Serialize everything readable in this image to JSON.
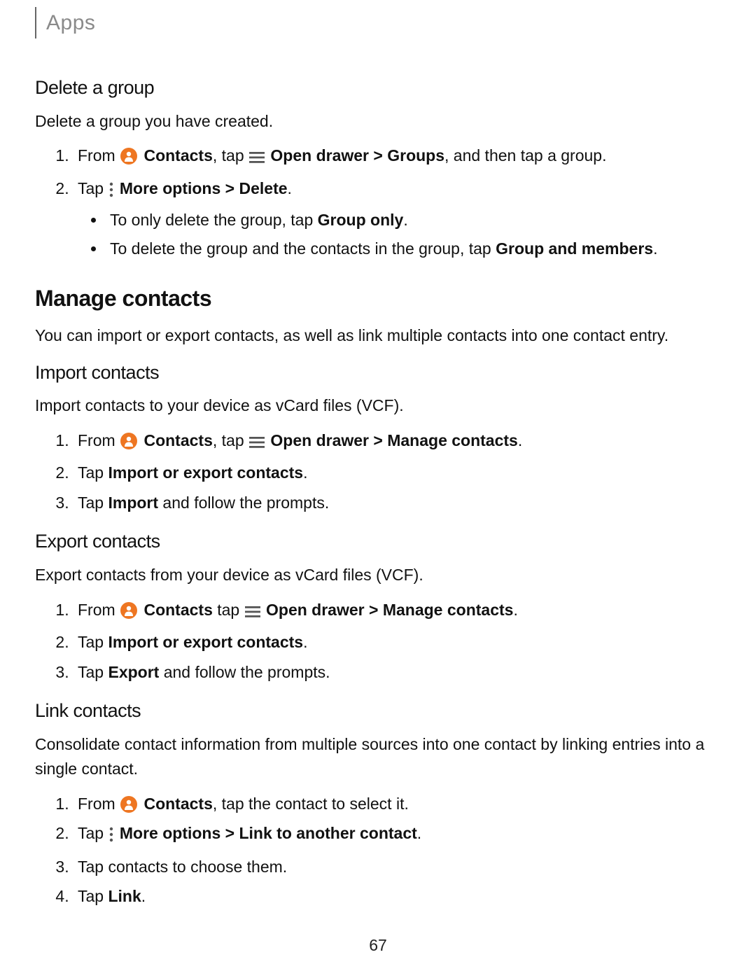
{
  "breadcrumb": "Apps",
  "pagenum": "67",
  "sections": {
    "delete_group": {
      "title": "Delete a group",
      "intro": "Delete a group you have created.",
      "step1": {
        "from": "From ",
        "contacts": "Contacts",
        "comma_tap": ", tap ",
        "open_drawer": "Open drawer",
        "gt": " > ",
        "groups": "Groups",
        "rest": ", and then tap a group."
      },
      "step2": {
        "tap": "Tap ",
        "more_options": "More options",
        "gt": " > ",
        "delete": "Delete",
        "period": "."
      },
      "bullets": {
        "b1_a": "To only delete the group, tap ",
        "b1_bold": "Group only",
        "b1_b": ".",
        "b2_a": "To delete the group and the contacts in the group, tap ",
        "b2_bold": "Group and members",
        "b2_b": "."
      }
    },
    "manage_contacts": {
      "title": "Manage contacts",
      "intro": "You can import or export contacts, as well as link multiple contacts into one contact entry."
    },
    "import_contacts": {
      "title": "Import contacts",
      "intro": "Import contacts to your device as vCard files (VCF).",
      "step1": {
        "from": "From ",
        "contacts": "Contacts",
        "comma_tap": ", tap ",
        "open_drawer": "Open drawer",
        "gt": " > ",
        "manage": "Manage contacts",
        "period": "."
      },
      "step2_a": "Tap ",
      "step2_bold": "Import or export contacts",
      "step2_b": ".",
      "step3_a": "Tap ",
      "step3_bold": "Import",
      "step3_b": " and follow the prompts."
    },
    "export_contacts": {
      "title": "Export contacts",
      "intro": "Export contacts from your device as vCard files (VCF).",
      "step1": {
        "from": "From ",
        "contacts": "Contacts",
        "space_tap": " tap ",
        "open_drawer": "Open drawer",
        "gt": " > ",
        "manage": "Manage contacts",
        "period": "."
      },
      "step2_a": "Tap ",
      "step2_bold": "Import or export contacts",
      "step2_b": ".",
      "step3_a": "Tap ",
      "step3_bold": "Export",
      "step3_b": " and follow the prompts."
    },
    "link_contacts": {
      "title": "Link contacts",
      "intro": "Consolidate contact information from multiple sources into one contact by linking entries into a single contact.",
      "step1": {
        "from": "From ",
        "contacts": "Contacts",
        "rest": ", tap the contact to select it."
      },
      "step2": {
        "tap": "Tap ",
        "more_options": "More options",
        "gt": " > ",
        "link": "Link to another contact",
        "period": "."
      },
      "step3": "Tap contacts to choose them.",
      "step4_a": "Tap ",
      "step4_bold": "Link",
      "step4_b": "."
    }
  }
}
